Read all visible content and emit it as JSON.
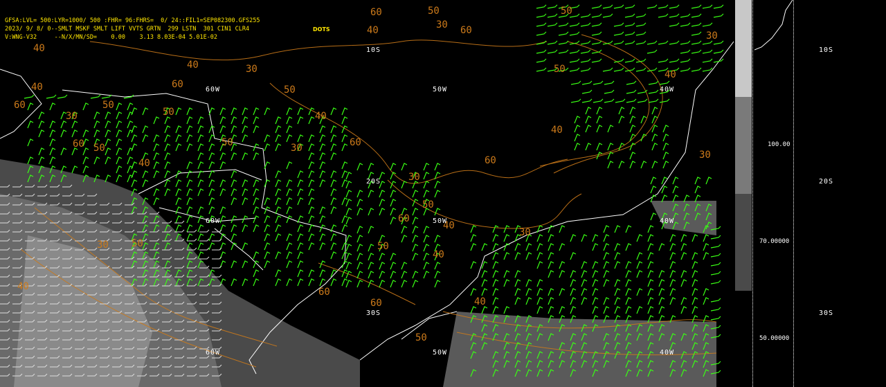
{
  "header": {
    "line1": "GFSA:LVL= 500:LYR=1000/ 500 :FHR= 96:FHRS=  0/ 24::FIL1=SEP082300.GFS255",
    "line2": "2023/ 9/ 8/ 0--SMLT MSKF SMLT LIFT VVTS GRTN  299 LSTN  301 CIN1 CLR4",
    "line3": "V:WNG-V32     --N/X/MN/SD=    0.00    3.13 8.03E-04 5.01E-02",
    "dots_label": "DOTS"
  },
  "grid_labels": {
    "lon_60w": "60W",
    "lon_50w": "50W",
    "lon_40w": "40W",
    "lat_10s": "10S",
    "lat_20s": "20S",
    "lat_30s": "30S"
  },
  "colorbar": {
    "ticks": [
      "100.00",
      "70.00000",
      "50.00000"
    ],
    "shades": [
      "#c8c8c8",
      "#7a7a7a",
      "#555555",
      "#3a3a3a"
    ]
  },
  "right_panel_labels": {
    "a": "10S",
    "b": "20S",
    "c": "30S"
  },
  "contour_values": [
    "60",
    "50",
    "40",
    "30",
    "60",
    "50",
    "40",
    "30",
    "50",
    "40",
    "60",
    "30",
    "50",
    "40"
  ],
  "colors": {
    "contour": "#cc7a1a",
    "wind": "#39ff14",
    "header": "#ffe600",
    "coast": "#ffffff"
  }
}
